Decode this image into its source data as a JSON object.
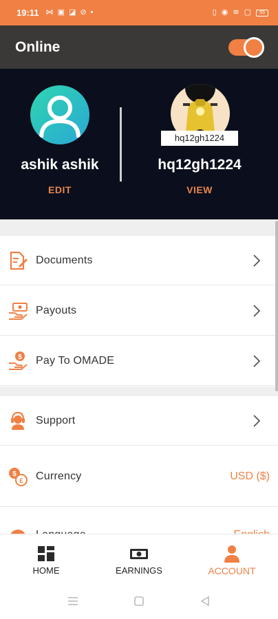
{
  "status_bar": {
    "time": "19:11",
    "left_icons": [
      "missed-call-icon",
      "app-notification-icon",
      "app-notification-icon",
      "sync-icon",
      "dot-icon"
    ],
    "right_icons": [
      "vibrate-icon",
      "location-icon",
      "wifi-icon",
      "alarm-icon",
      "battery-icon"
    ],
    "battery_level": "55"
  },
  "header": {
    "title": "Online",
    "toggle_on": true
  },
  "profile": {
    "user_name": "ashik ashik",
    "user_action": "EDIT",
    "vehicle_label": "hq12gh1224",
    "vehicle_name": "hq12gh1224",
    "vehicle_action": "VIEW"
  },
  "menu": {
    "items": [
      {
        "label": "Documents",
        "icon": "documents-icon"
      },
      {
        "label": "Payouts",
        "icon": "payouts-icon"
      },
      {
        "label": "Pay To OMADE",
        "icon": "pay-icon"
      },
      {
        "label": "Support",
        "icon": "support-icon"
      },
      {
        "label": "Currency",
        "icon": "currency-icon",
        "value": "USD ($)"
      },
      {
        "label": "Language",
        "icon": "language-icon",
        "value": "English"
      }
    ]
  },
  "bottom_nav": {
    "items": [
      {
        "label": "HOME",
        "icon": "home-icon",
        "active": false
      },
      {
        "label": "EARNINGS",
        "icon": "earnings-icon",
        "active": false
      },
      {
        "label": "ACCOUNT",
        "icon": "account-icon",
        "active": true
      }
    ]
  },
  "colors": {
    "accent": "#f08044",
    "header_bg": "#3a3937",
    "profile_bg": "#0b0e1c"
  }
}
